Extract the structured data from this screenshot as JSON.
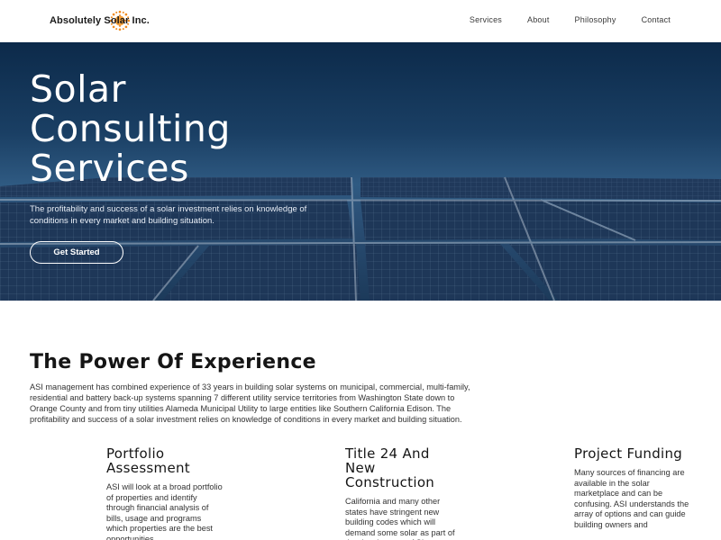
{
  "header": {
    "logo_text": "Absolutely Solar Inc.",
    "nav": [
      "Services",
      "About",
      "Philosophy",
      "Contact"
    ]
  },
  "hero": {
    "title_lines": [
      "Solar",
      "Consulting",
      "Services"
    ],
    "subtitle": "The profitability and success of a solar investment relies on knowledge of conditions in every market and building situation.",
    "cta_label": "Get Started"
  },
  "experience": {
    "title": "The Power Of Experience",
    "body": "ASI management has combined experience of 33 years in building solar systems on municipal, commercial, multi-family, residential and battery back-up systems spanning 7 different utility service territories from Washington State down to Orange County and from tiny utilities Alameda Municipal Utility to large entities like Southern California Edison. The profitability and success of a solar investment relies on knowledge of conditions in every market and building situation."
  },
  "features": [
    {
      "title": "Portfolio Assessment",
      "text": "ASI will look at a broad portfolio of properties and identify through financial analysis of bills, usage and programs which properties are the best opportunities"
    },
    {
      "title": "Title 24 And New Construction",
      "text": "California and many other states have stringent new building codes which will demand some solar as part of the development. ASI"
    },
    {
      "title": "Project Funding",
      "text": "Many sources of financing are available in the solar marketplace and can be confusing. ASI understands the array of options and can guide building owners and"
    }
  ],
  "colors": {
    "hero_sky_top": "#0c2a4a",
    "hero_sky_bottom": "#2f5a82",
    "logo_sun": "#f08a1c"
  }
}
